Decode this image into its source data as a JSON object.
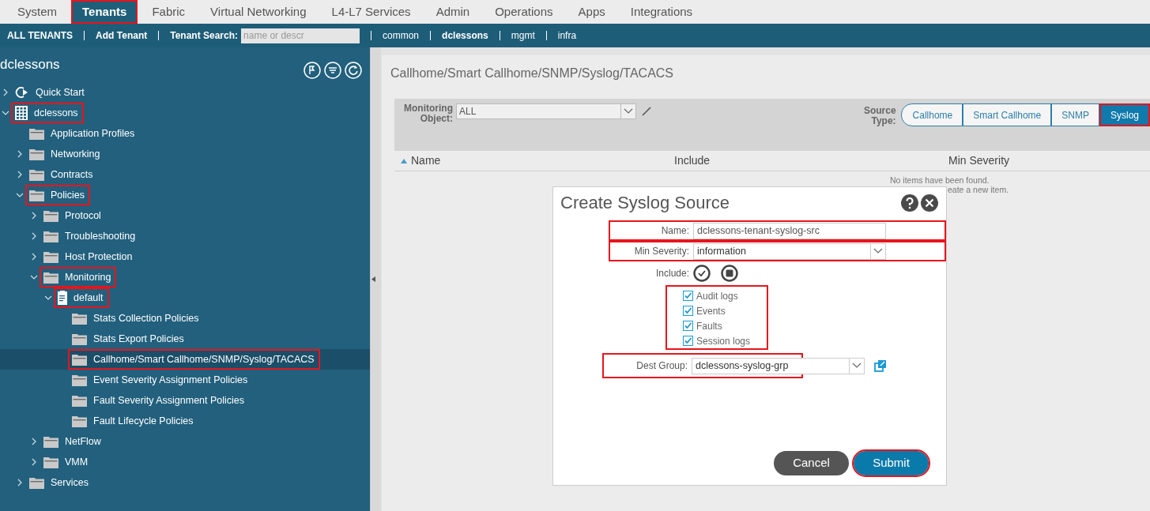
{
  "top_tabs": [
    {
      "label": "System",
      "selected": false,
      "highlighted": false
    },
    {
      "label": "Tenants",
      "selected": true,
      "highlighted": true
    },
    {
      "label": "Fabric",
      "selected": false,
      "highlighted": false
    },
    {
      "label": "Virtual Networking",
      "selected": false,
      "highlighted": false
    },
    {
      "label": "L4-L7 Services",
      "selected": false,
      "highlighted": false
    },
    {
      "label": "Admin",
      "selected": false,
      "highlighted": false
    },
    {
      "label": "Operations",
      "selected": false,
      "highlighted": false
    },
    {
      "label": "Apps",
      "selected": false,
      "highlighted": false
    },
    {
      "label": "Integrations",
      "selected": false,
      "highlighted": false
    }
  ],
  "tenant_bar": {
    "all_tenants": "ALL TENANTS",
    "add_tenant": "Add Tenant",
    "search_label": "Tenant Search:",
    "search_placeholder": "name or descr",
    "tenants": [
      {
        "label": "common",
        "selected": false
      },
      {
        "label": "dclessons",
        "selected": true
      },
      {
        "label": "mgmt",
        "selected": false
      },
      {
        "label": "infra",
        "selected": false
      }
    ]
  },
  "sidebar": {
    "title": "dclessons",
    "tree": [
      {
        "label": "Quick Start",
        "kind": "quickstart",
        "expanded": false,
        "selected": false,
        "highlighted": false
      },
      {
        "label": "dclessons",
        "kind": "tenant",
        "expanded": true,
        "selected": false,
        "highlighted": true,
        "children": [
          {
            "label": "Application Profiles",
            "kind": "folder",
            "selected": false,
            "highlighted": false
          },
          {
            "label": "Networking",
            "kind": "folder",
            "expanded": false,
            "selected": false,
            "highlighted": false
          },
          {
            "label": "Contracts",
            "kind": "folder",
            "expanded": false,
            "selected": false,
            "highlighted": false
          },
          {
            "label": "Policies",
            "kind": "folder",
            "expanded": true,
            "selected": false,
            "highlighted": true,
            "children": [
              {
                "label": "Protocol",
                "kind": "folder",
                "expanded": false,
                "selected": false,
                "highlighted": false
              },
              {
                "label": "Troubleshooting",
                "kind": "folder",
                "expanded": false,
                "selected": false,
                "highlighted": false
              },
              {
                "label": "Host Protection",
                "kind": "folder",
                "expanded": false,
                "selected": false,
                "highlighted": false
              },
              {
                "label": "Monitoring",
                "kind": "folder",
                "expanded": true,
                "selected": false,
                "highlighted": true,
                "children": [
                  {
                    "label": "default",
                    "kind": "document",
                    "expanded": true,
                    "selected": false,
                    "highlighted": true,
                    "children": [
                      {
                        "label": "Stats Collection Policies",
                        "kind": "folder",
                        "selected": false,
                        "highlighted": false
                      },
                      {
                        "label": "Stats Export Policies",
                        "kind": "folder",
                        "selected": false,
                        "highlighted": false
                      },
                      {
                        "label": "Callhome/Smart Callhome/SNMP/Syslog/TACACS",
                        "kind": "folder",
                        "selected": true,
                        "highlighted": true
                      },
                      {
                        "label": "Event Severity Assignment Policies",
                        "kind": "folder",
                        "selected": false,
                        "highlighted": false
                      },
                      {
                        "label": "Fault Severity Assignment Policies",
                        "kind": "folder",
                        "selected": false,
                        "highlighted": false
                      },
                      {
                        "label": "Fault Lifecycle Policies",
                        "kind": "folder",
                        "selected": false,
                        "highlighted": false
                      }
                    ]
                  }
                ]
              },
              {
                "label": "NetFlow",
                "kind": "folder",
                "expanded": false,
                "selected": false,
                "highlighted": false
              },
              {
                "label": "VMM",
                "kind": "folder",
                "expanded": false,
                "selected": false,
                "highlighted": false
              }
            ]
          },
          {
            "label": "Services",
            "kind": "folder",
            "expanded": false,
            "selected": false,
            "highlighted": false
          }
        ]
      }
    ]
  },
  "content": {
    "title": "Callhome/Smart Callhome/SNMP/Syslog/TACACS",
    "monitoring_object": {
      "label": "Monitoring Object:",
      "value": "ALL"
    },
    "source_type": {
      "label": "Source Type:",
      "options": [
        {
          "label": "Callhome",
          "selected": false,
          "highlighted": false
        },
        {
          "label": "Smart Callhome",
          "selected": false,
          "highlighted": false
        },
        {
          "label": "SNMP",
          "selected": false,
          "highlighted": false
        },
        {
          "label": "Syslog",
          "selected": true,
          "highlighted": true
        }
      ]
    },
    "table": {
      "columns": [
        "Name",
        "Include",
        "Min Severity"
      ],
      "empty_lines": [
        "No items have been found.",
        "eate a new item."
      ]
    }
  },
  "dialog": {
    "title": "Create Syslog Source",
    "name": {
      "label": "Name:",
      "value": "dclessons-tenant-syslog-src",
      "highlighted": true
    },
    "min_severity": {
      "label": "Min Severity:",
      "value": "information",
      "highlighted": true
    },
    "include": {
      "label": "Include:",
      "highlighted": true,
      "options": [
        {
          "label": "Audit logs",
          "checked": true
        },
        {
          "label": "Events",
          "checked": true
        },
        {
          "label": "Faults",
          "checked": true
        },
        {
          "label": "Session logs",
          "checked": true
        }
      ]
    },
    "dest_group": {
      "label": "Dest Group:",
      "value": "dclessons-syslog-grp",
      "highlighted": true
    },
    "buttons": [
      {
        "label": "Cancel",
        "kind": "secondary",
        "highlighted": false
      },
      {
        "label": "Submit",
        "kind": "primary",
        "highlighted": true
      }
    ]
  }
}
